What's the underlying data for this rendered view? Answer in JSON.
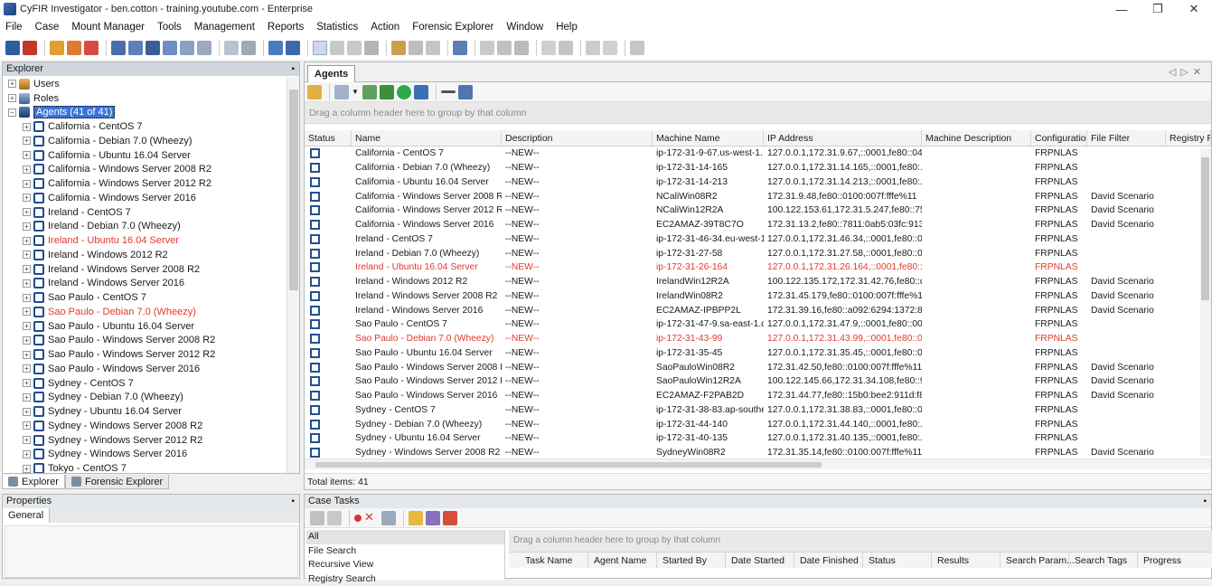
{
  "window": {
    "title": "CyFIR Investigator - ben.cotton - training.youtube.com - Enterprise"
  },
  "menu": [
    "File",
    "Case",
    "Mount Manager",
    "Tools",
    "Management",
    "Reports",
    "Statistics",
    "Action",
    "Forensic Explorer",
    "Window",
    "Help"
  ],
  "explorer": {
    "title": "Explorer",
    "nodes": {
      "users": "Users",
      "roles": "Roles",
      "agents": "Agents (41 of 41)"
    },
    "agents": [
      {
        "label": "California - CentOS 7"
      },
      {
        "label": "California - Debian 7.0 (Wheezy)"
      },
      {
        "label": "California - Ubuntu 16.04 Server"
      },
      {
        "label": "California - Windows Server 2008 R2"
      },
      {
        "label": "California - Windows Server 2012 R2"
      },
      {
        "label": "California - Windows Server 2016"
      },
      {
        "label": "Ireland - CentOS 7"
      },
      {
        "label": "Ireland - Debian 7.0 (Wheezy)"
      },
      {
        "label": "Ireland - Ubuntu 16.04 Server",
        "alert": true
      },
      {
        "label": "Ireland - Windows 2012 R2"
      },
      {
        "label": "Ireland - Windows Server 2008 R2"
      },
      {
        "label": "Ireland - Windows Server 2016"
      },
      {
        "label": "Sao Paulo - CentOS 7"
      },
      {
        "label": "Sao Paulo - Debian 7.0 (Wheezy)",
        "alert": true
      },
      {
        "label": "Sao Paulo - Ubuntu 16.04 Server"
      },
      {
        "label": "Sao Paulo - Windows Server 2008 R2"
      },
      {
        "label": "Sao Paulo - Windows Server 2012 R2"
      },
      {
        "label": "Sao Paulo - Windows Server 2016"
      },
      {
        "label": "Sydney - CentOS 7"
      },
      {
        "label": "Sydney - Debian 7.0 (Wheezy)"
      },
      {
        "label": "Sydney - Ubuntu 16.04 Server"
      },
      {
        "label": "Sydney - Windows Server 2008 R2"
      },
      {
        "label": "Sydney - Windows Server 2012 R2"
      },
      {
        "label": "Sydney - Windows Server 2016"
      },
      {
        "label": "Tokyo - CentOS 7"
      }
    ],
    "tabs": [
      "Explorer",
      "Forensic Explorer"
    ]
  },
  "properties": {
    "title": "Properties",
    "tab": "General"
  },
  "agents_doc": {
    "tab": "Agents",
    "group_hint": "Drag a column header here to group by that column",
    "columns": [
      "Status",
      "Name",
      "Description",
      "Machine Name",
      "IP Address",
      "Machine Description",
      "Configuration",
      "File Filter",
      "Registry Filt"
    ],
    "rows": [
      {
        "name": "California - CentOS 7",
        "desc": "--NEW--",
        "machine": "ip-172-31-9-67.us-west-1....",
        "ip": "127.0.0.1,172.31.9.67,::0001,fe80::04...",
        "mdesc": "",
        "config": "FRPNLAS",
        "filter": ""
      },
      {
        "name": "California - Debian 7.0 (Wheezy)",
        "desc": "--NEW--",
        "machine": "ip-172-31-14-165",
        "ip": "127.0.0.1,172.31.14.165,::0001,fe80:...",
        "mdesc": "",
        "config": "FRPNLAS",
        "filter": ""
      },
      {
        "name": "California - Ubuntu 16.04 Server",
        "desc": "--NEW--",
        "machine": "ip-172-31-14-213",
        "ip": "127.0.0.1,172.31.14.213,::0001,fe80:...",
        "mdesc": "",
        "config": "FRPNLAS",
        "filter": ""
      },
      {
        "name": "California - Windows Server 2008 R2",
        "desc": "--NEW--",
        "machine": "NCaliWin08R2",
        "ip": "172.31.9.48,fe80::0100:007f:fffe%11",
        "mdesc": "",
        "config": "FRPNLAS",
        "filter": "David Scenario"
      },
      {
        "name": "California - Windows Server 2012 R2",
        "desc": "--NEW--",
        "machine": "NCaliWin12R2A",
        "ip": "100.122.153.61,172.31.5.247,fe80::75...",
        "mdesc": "",
        "config": "FRPNLAS",
        "filter": "David Scenario"
      },
      {
        "name": "California - Windows Server 2016",
        "desc": "--NEW--",
        "machine": "EC2AMAZ-39T8C7O",
        "ip": "172.31.13.2,fe80::7811:0ab5:03fc:913...",
        "mdesc": "",
        "config": "FRPNLAS",
        "filter": "David Scenario"
      },
      {
        "name": "Ireland - CentOS 7",
        "desc": "--NEW--",
        "machine": "ip-172-31-46-34.eu-west-1...",
        "ip": "127.0.0.1,172.31.46.34,::0001,fe80::0...",
        "mdesc": "",
        "config": "FRPNLAS",
        "filter": ""
      },
      {
        "name": "Ireland - Debian 7.0 (Wheezy)",
        "desc": "--NEW--",
        "machine": "ip-172-31-27-58",
        "ip": "127.0.0.1,172.31.27.58,::0001,fe80::0...",
        "mdesc": "",
        "config": "FRPNLAS",
        "filter": ""
      },
      {
        "name": "Ireland - Ubuntu 16.04 Server",
        "desc": "--NEW--",
        "machine": "ip-172-31-26-164",
        "ip": "127.0.0.1,172.31.26.164,::0001,fe80::0...",
        "mdesc": "",
        "config": "FRPNLAS",
        "filter": "",
        "alert": true
      },
      {
        "name": "Ireland - Windows 2012 R2",
        "desc": "--NEW--",
        "machine": "IrelandWin12R2A",
        "ip": "100.122.135.172,172.31.42.76,fe80::d...",
        "mdesc": "",
        "config": "FRPNLAS",
        "filter": "David Scenario"
      },
      {
        "name": "Ireland - Windows Server 2008 R2",
        "desc": "--NEW--",
        "machine": "IrelandWin08R2",
        "ip": "172.31.45.179,fe80::0100:007f:fffe%11",
        "mdesc": "",
        "config": "FRPNLAS",
        "filter": "David Scenario"
      },
      {
        "name": "Ireland - Windows Server 2016",
        "desc": "--NEW--",
        "machine": "EC2AMAZ-IPBPP2L",
        "ip": "172.31.39.16,fe80::a092:6294:1372:8...",
        "mdesc": "",
        "config": "FRPNLAS",
        "filter": "David Scenario"
      },
      {
        "name": "Sao Paulo - CentOS 7",
        "desc": "--NEW--",
        "machine": "ip-172-31-47-9.sa-east-1.c...",
        "ip": "127.0.0.1,172.31.47.9,::0001,fe80::00...",
        "mdesc": "",
        "config": "FRPNLAS",
        "filter": ""
      },
      {
        "name": "Sao Paulo - Debian 7.0 (Wheezy)",
        "desc": "--NEW--",
        "machine": "ip-172-31-43-99",
        "ip": "127.0.0.1,172.31.43.99,::0001,fe80::0...",
        "mdesc": "",
        "config": "FRPNLAS",
        "filter": "",
        "alert": true
      },
      {
        "name": "Sao Paulo - Ubuntu 16.04 Server",
        "desc": "--NEW--",
        "machine": "ip-172-31-35-45",
        "ip": "127.0.0.1,172.31.35.45,::0001,fe80::0...",
        "mdesc": "",
        "config": "FRPNLAS",
        "filter": ""
      },
      {
        "name": "Sao Paulo - Windows Server 2008 R2",
        "desc": "--NEW--",
        "machine": "SaoPauloWin08R2",
        "ip": "172.31.42.50,fe80::0100:007f:fffe%11",
        "mdesc": "",
        "config": "FRPNLAS",
        "filter": "David Scenario"
      },
      {
        "name": "Sao Paulo - Windows Server 2012 R2",
        "desc": "--NEW--",
        "machine": "SaoPauloWin12R2A",
        "ip": "100.122.145.66,172.31.34.108,fe80::9...",
        "mdesc": "",
        "config": "FRPNLAS",
        "filter": "David Scenario"
      },
      {
        "name": "Sao Paulo - Windows Server 2016",
        "desc": "--NEW--",
        "machine": "EC2AMAZ-F2PAB2D",
        "ip": "172.31.44.77,fe80::15b0:bee2:911d:f8...",
        "mdesc": "",
        "config": "FRPNLAS",
        "filter": "David Scenario"
      },
      {
        "name": "Sydney - CentOS 7",
        "desc": "--NEW--",
        "machine": "ip-172-31-38-83.ap-southe...",
        "ip": "127.0.0.1,172.31.38.83,::0001,fe80::0...",
        "mdesc": "",
        "config": "FRPNLAS",
        "filter": ""
      },
      {
        "name": "Sydney - Debian 7.0 (Wheezy)",
        "desc": "--NEW--",
        "machine": "ip-172-31-44-140",
        "ip": "127.0.0.1,172.31.44.140,::0001,fe80:...",
        "mdesc": "",
        "config": "FRPNLAS",
        "filter": ""
      },
      {
        "name": "Sydney - Ubuntu 16.04 Server",
        "desc": "--NEW--",
        "machine": "ip-172-31-40-135",
        "ip": "127.0.0.1,172.31.40.135,::0001,fe80:...",
        "mdesc": "",
        "config": "FRPNLAS",
        "filter": ""
      },
      {
        "name": "Sydney - Windows Server 2008 R2",
        "desc": "--NEW--",
        "machine": "SydneyWin08R2",
        "ip": "172.31.35.14,fe80::0100:007f:fffe%11",
        "mdesc": "",
        "config": "FRPNLAS",
        "filter": "David Scenario"
      }
    ],
    "total": "Total items: 41"
  },
  "case_tasks": {
    "title": "Case Tasks",
    "list": [
      "All",
      "File Search",
      "Recursive View",
      "Registry Search"
    ],
    "group_hint": "Drag a column header here to group by that column",
    "columns": [
      "Task Name",
      "Agent Name",
      "Started By",
      "Date Started",
      "Date Finished",
      "Status",
      "Results",
      "Search Param...",
      "Search Tags",
      "Progress"
    ]
  },
  "colors": {
    "alert": "#e03a2b",
    "selection": "#3874d8",
    "panel_header": "#cfd6de"
  }
}
